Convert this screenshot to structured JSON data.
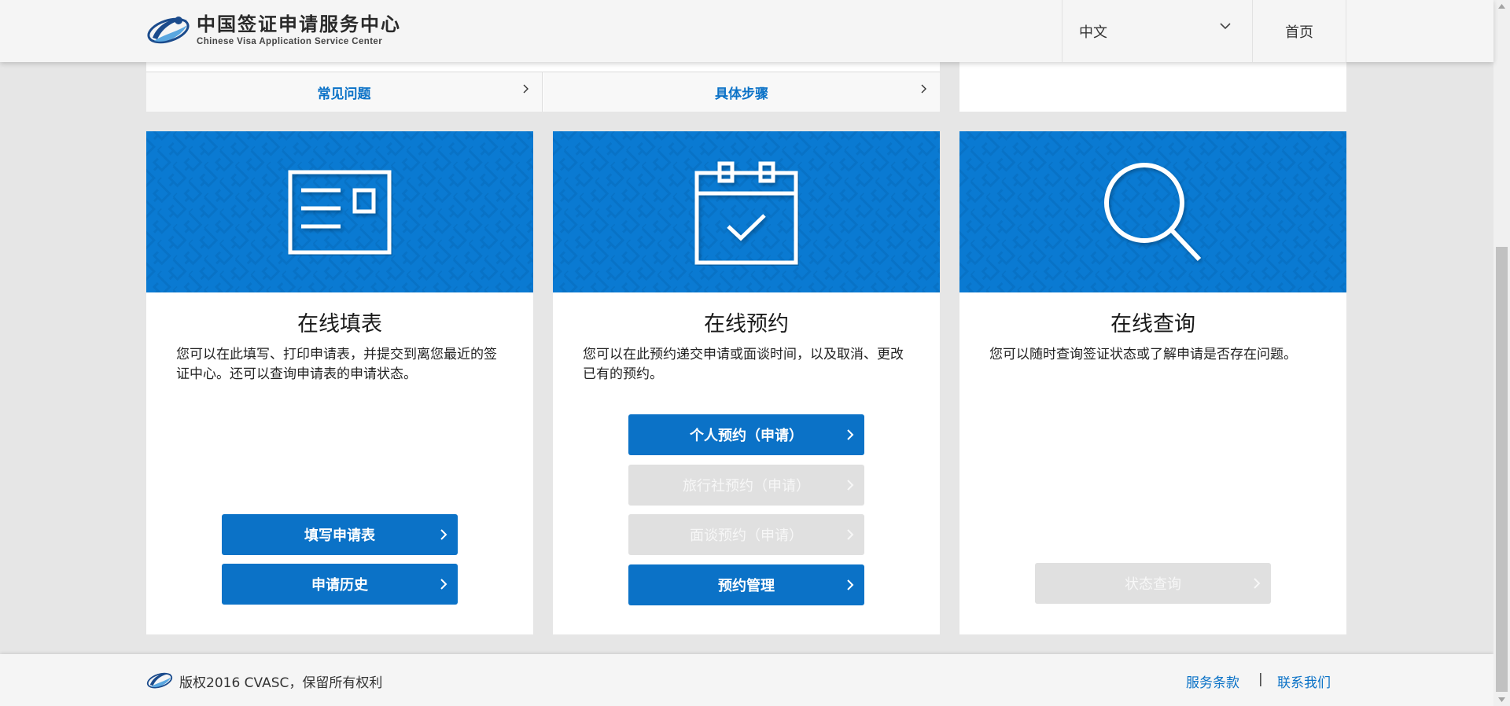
{
  "header": {
    "logo_cn": "中国签证申请服务中心",
    "logo_en": "Chinese Visa Application Service Center",
    "language": "中文",
    "home": "首页"
  },
  "quick_links": [
    {
      "label": "常见问题"
    },
    {
      "label": "具体步骤"
    }
  ],
  "cards": [
    {
      "title": "在线填表",
      "description": "您可以在此填写、打印申请表，并提交到离您最近的签证中心。还可以查询申请表的申请状态。",
      "icon": "application-form-icon",
      "buttons": [
        {
          "label": "填写申请表",
          "enabled": true
        },
        {
          "label": "申请历史",
          "enabled": true
        }
      ]
    },
    {
      "title": "在线预约",
      "description": "您可以在此预约递交申请或面谈时间，以及取消、更改已有的预约。",
      "icon": "calendar-check-icon",
      "buttons": [
        {
          "label": "个人预约（申请）",
          "enabled": true
        },
        {
          "label": "旅行社预约（申请）",
          "enabled": false
        },
        {
          "label": "面谈预约（申请）",
          "enabled": false
        },
        {
          "label": "预约管理",
          "enabled": true
        }
      ]
    },
    {
      "title": "在线查询",
      "description": "您可以随时查询签证状态或了解申请是否存在问题。",
      "icon": "search-icon",
      "buttons": [
        {
          "label": "状态查询",
          "enabled": false
        }
      ]
    }
  ],
  "footer": {
    "copyright": "版权2016 CVASC，保留所有权利",
    "terms": "服务条款",
    "separator": "|",
    "contact": "联系我们"
  },
  "colors": {
    "primary": "#0b72c7",
    "banner": "#0a7ad2",
    "disabled": "#e0e0e0",
    "page_bg": "#e6e6e6"
  }
}
